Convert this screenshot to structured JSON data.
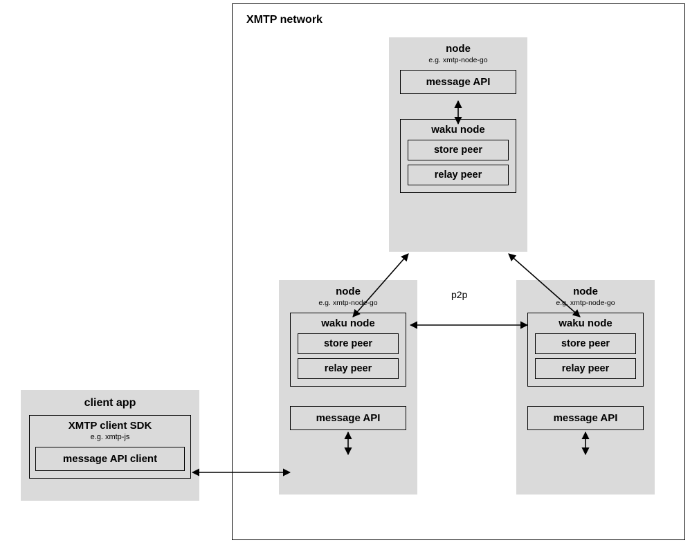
{
  "network": {
    "title": "XMTP network",
    "p2p_label": "p2p"
  },
  "client": {
    "title": "client app",
    "sdk_title": "XMTP client SDK",
    "sdk_subtitle": "e.g. xmtp-js",
    "msg_api_client": "message API client"
  },
  "node": {
    "title": "node",
    "subtitle": "e.g. xmtp-node-go",
    "waku_title": "waku node",
    "store_peer": "store peer",
    "relay_peer": "relay peer",
    "message_api": "message API"
  }
}
